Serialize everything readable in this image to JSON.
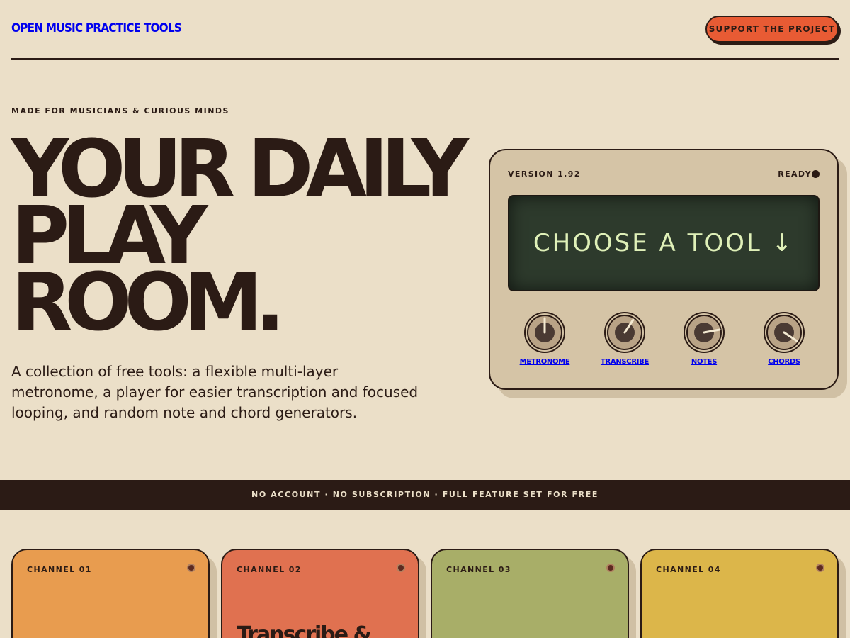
{
  "header": {
    "logo": "OPEN MUSIC PRACTICE TOOLS",
    "support_label": "SUPPORT THE PROJECT"
  },
  "hero": {
    "eyebrow": "MADE FOR MUSICIANS & CURIOUS MINDS",
    "title_lines": [
      "YOUR DAILY",
      "PLAY",
      "ROOM."
    ],
    "description": "A collection of free tools: a flexible multi-layer metronome, a player for easier transcription and focused looping, and random note and chord generators."
  },
  "device": {
    "version": "VERSION 1.92",
    "status": "READY",
    "screen_text": "CHOOSE A TOOL ↓",
    "knobs": [
      {
        "label": "METRONOME",
        "icon": "knob-icon"
      },
      {
        "label": "TRANSCRIBE",
        "icon": "knob-icon"
      },
      {
        "label": "NOTES",
        "icon": "knob-icon"
      },
      {
        "label": "CHORDS",
        "icon": "knob-icon"
      }
    ]
  },
  "banner": "NO ACCOUNT · NO SUBSCRIPTION · FULL FEATURE SET FOR FREE",
  "channels": [
    {
      "label": "CHANNEL 01",
      "title": "",
      "color": "#e89c4f"
    },
    {
      "label": "CHANNEL 02",
      "title": "Transcribe &",
      "color": "#e07150"
    },
    {
      "label": "CHANNEL 03",
      "title": "",
      "color": "#a8ae68"
    },
    {
      "label": "CHANNEL 04",
      "title": "",
      "color": "#dcb64a"
    }
  ],
  "colors": {
    "background": "#ebdfc8",
    "ink": "#2b1b15",
    "accent": "#e85b34",
    "link": "#0000ee",
    "screen": "#2d3a2c",
    "screen_text": "#dff0b8"
  }
}
